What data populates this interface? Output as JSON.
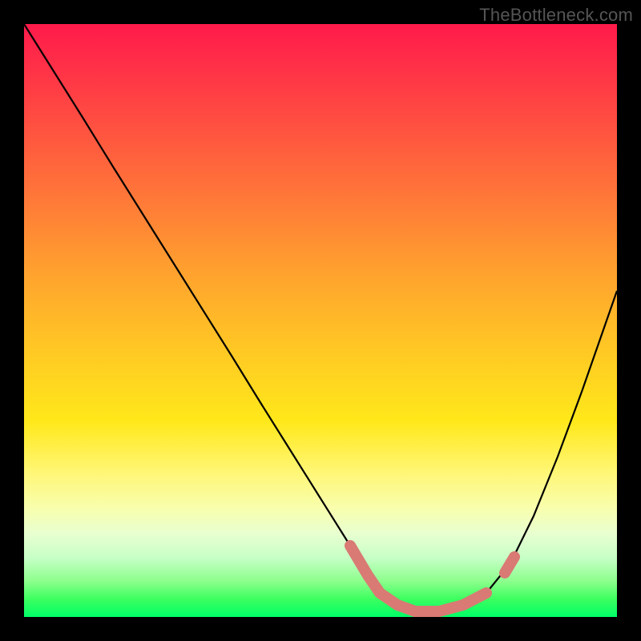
{
  "watermark": "TheBottleneck.com",
  "colors": {
    "curve_stroke": "#000000",
    "highlight_stroke": "#d97a74",
    "background": "#000000"
  },
  "chart_data": {
    "type": "line",
    "title": "",
    "xlabel": "",
    "ylabel": "",
    "xlim": [
      0,
      100
    ],
    "ylim": [
      0,
      100
    ],
    "grid": false,
    "legend": false,
    "annotations": [],
    "series": [
      {
        "name": "bottleneck-curve",
        "x": [
          0,
          5,
          10,
          15,
          20,
          25,
          30,
          35,
          40,
          45,
          50,
          55,
          58,
          60,
          63,
          66,
          70,
          74,
          78,
          82,
          86,
          90,
          94,
          100
        ],
        "values": [
          100,
          92,
          84,
          76,
          68,
          60,
          52,
          44,
          36,
          28,
          20,
          12,
          7,
          4,
          2,
          1,
          1,
          2,
          4,
          9,
          17,
          27,
          38,
          55
        ]
      },
      {
        "name": "highlight-trough",
        "x": [
          55,
          58,
          60,
          63,
          66,
          70,
          74,
          78
        ],
        "values": [
          12,
          7,
          4,
          2,
          1,
          1,
          2,
          4
        ]
      }
    ]
  }
}
